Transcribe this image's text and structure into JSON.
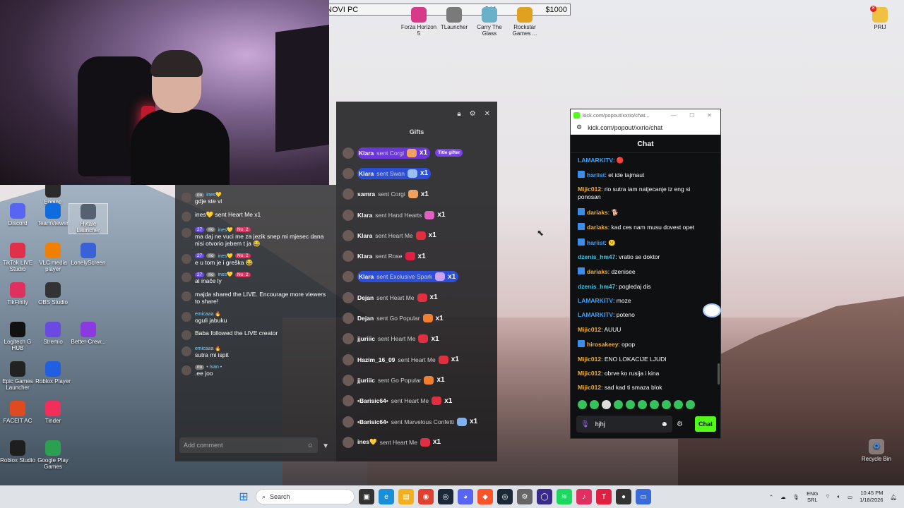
{
  "topbar": {
    "label": "NOVI PC",
    "mid": "$11",
    "right": "$1000"
  },
  "top_icons": [
    {
      "label": "Forza Horizon 5",
      "color": "#d83a8a"
    },
    {
      "label": "TLauncher",
      "color": "#7a7a7a"
    },
    {
      "label": "Carry The Glass",
      "color": "#6ab0c8"
    },
    {
      "label": "Rockstar Games ...",
      "color": "#e0a020"
    }
  ],
  "pril": "PRIJ",
  "left_icons": [
    {
      "label": "Engine",
      "color": "#2a2a2a"
    },
    {
      "label": "Discord",
      "color": "#5865f2"
    },
    {
      "label": "TeamViewer",
      "color": "#0e6be0"
    },
    {
      "label": "Hytale Launcher",
      "color": "#556070"
    },
    {
      "label": "TikTok LIVE Studio",
      "color": "#e0304a"
    },
    {
      "label": "VLC media player",
      "color": "#f08000"
    },
    {
      "label": "LonelyScreen",
      "color": "#3a62d8"
    },
    {
      "label": "TikFinity",
      "color": "#e03060"
    },
    {
      "label": "OBS Studio",
      "color": "#333333"
    },
    {
      "label": "Logitech G HUB",
      "color": "#111111"
    },
    {
      "label": "Stremio",
      "color": "#6a4ae0"
    },
    {
      "label": "Better-Crew...",
      "color": "#8a3ae0"
    },
    {
      "label": "Epic Games Launcher",
      "color": "#222222"
    },
    {
      "label": "Roblox Player",
      "color": "#2060e0"
    },
    {
      "label": "FACEIT AC",
      "color": "#e04a20"
    },
    {
      "label": "Tinder",
      "color": "#f0305a"
    },
    {
      "label": "Roblox Studio",
      "color": "#1e1e1e"
    },
    {
      "label": "Google Play Games",
      "color": "#2aa050"
    }
  ],
  "recycle_bin": "Recycle Bin",
  "live": {
    "gifts_title": "Gifts",
    "gifts": [
      {
        "name": "Klara",
        "gift": "sent Corgi",
        "count": "x1",
        "badge": "Title gifter",
        "style": "purple",
        "color": "#f0a060"
      },
      {
        "name": "Klara",
        "gift": "sent Swan",
        "count": "x1",
        "badge": "",
        "style": "blue",
        "color": "#9ac0f0"
      },
      {
        "name": "samra",
        "gift": "sent Corgi",
        "count": "x1",
        "badge": "",
        "style": "",
        "color": "#f0a060"
      },
      {
        "name": "Klara",
        "gift": "sent Hand Hearts",
        "count": "x1",
        "badge": "",
        "style": "",
        "color": "#e060c0"
      },
      {
        "name": "Klara",
        "gift": "sent Heart Me",
        "count": "x1",
        "badge": "",
        "style": "",
        "color": "#e03040"
      },
      {
        "name": "Klara",
        "gift": "sent Rose",
        "count": "x1",
        "badge": "",
        "style": "",
        "color": "#e02040"
      },
      {
        "name": "Klara",
        "gift": "sent Exclusive Spark",
        "count": "x1",
        "badge": "",
        "style": "blue",
        "color": "#d0a0f0"
      },
      {
        "name": "Dejan",
        "gift": "sent Heart Me",
        "count": "x1",
        "badge": "",
        "style": "",
        "color": "#e03040"
      },
      {
        "name": "Dejan",
        "gift": "sent Go Popular",
        "count": "x1",
        "badge": "",
        "style": "",
        "color": "#f08030"
      },
      {
        "name": "jjuriiic",
        "gift": "sent Heart Me",
        "count": "x1",
        "badge": "",
        "style": "",
        "color": "#e03040"
      },
      {
        "name": "Hazim_16_09",
        "gift": "sent Heart Me",
        "count": "x1",
        "badge": "",
        "style": "",
        "color": "#e03040"
      },
      {
        "name": "jjuriiic",
        "gift": "sent Go Popular",
        "count": "x1",
        "badge": "",
        "style": "",
        "color": "#f08030"
      },
      {
        "name": "•Barisic64•",
        "gift": "sent Heart Me",
        "count": "x1",
        "badge": "",
        "style": "",
        "color": "#e03040"
      },
      {
        "name": "•Barisic64•",
        "gift": "sent Marvelous Confetti",
        "count": "x1",
        "badge": "",
        "style": "",
        "color": "#80b0f0"
      },
      {
        "name": "ines💛",
        "gift": "sent Heart Me",
        "count": "x1",
        "badge": "",
        "style": "",
        "color": "#e03040"
      }
    ],
    "comments": [
      {
        "tags": [
          "rio",
          "ines💛"
        ],
        "text": "gdje ste vi"
      },
      {
        "tags": [],
        "text": "ines💛 sent Heart Me x1"
      },
      {
        "tags": [
          "27",
          "rio",
          "ines💛",
          "No. 2"
        ],
        "text": "ma daj ne vuci me za jezik snep mi mjesec dana nisi otvorio jebem t ja 😂"
      },
      {
        "tags": [
          "27",
          "rio",
          "ines💛",
          "No. 2"
        ],
        "text": "e u tom je i greška 😂"
      },
      {
        "tags": [
          "27",
          "rio",
          "ines💛",
          "No. 2"
        ],
        "text": "al inače ly"
      },
      {
        "tags": [],
        "text": "majda shared the LIVE. Encourage more viewers to share!"
      },
      {
        "tags": [
          "emicaaa 🔥"
        ],
        "text": "oguli jabuku"
      },
      {
        "tags": [],
        "text": "Baba followed the LIVE creator"
      },
      {
        "tags": [
          "emicaaa 🔥"
        ],
        "text": "sutra mi ispit"
      },
      {
        "tags": [
          "rio",
          "• Ivan •"
        ],
        "text": ".ee joo"
      }
    ],
    "add_comment": "Add comment"
  },
  "kick": {
    "window_title": "kick.com/popout/xxrio/chat...",
    "url": "kick.com/popout/xxrio/chat",
    "header": "Chat",
    "messages": [
      {
        "user": "LAMARKITV",
        "text": "🔴",
        "cls": "u-blue",
        "icon": false
      },
      {
        "user": "hariist",
        "text": "et ide tajmaut",
        "cls": "u-blue",
        "icon": true
      },
      {
        "user": "Mijic012",
        "text": "rio sutra iam natjecanje iz eng si ponosan",
        "cls": "u-orange",
        "icon": false
      },
      {
        "user": "dariaks",
        "text": "🐕",
        "cls": "u-orange",
        "icon": true
      },
      {
        "user": "dariaks",
        "text": "kad ces nam musu dovest opet",
        "cls": "u-orange",
        "icon": true
      },
      {
        "user": "hariist",
        "text": "🙁",
        "cls": "u-blue",
        "icon": true
      },
      {
        "user": "dzenis_hm47",
        "text": "vratio se doktor",
        "cls": "u-cyan",
        "icon": false
      },
      {
        "user": "dariaks",
        "text": "dzenisee",
        "cls": "u-orange",
        "icon": true
      },
      {
        "user": "dzenis_hm47",
        "text": "pogledaj dis",
        "cls": "u-cyan",
        "icon": false
      },
      {
        "user": "LAMARKITV",
        "text": "moze",
        "cls": "u-blue",
        "icon": false
      },
      {
        "user": "LAMARKITV",
        "text": "poteno",
        "cls": "u-blue",
        "icon": false
      },
      {
        "user": "Mijic012",
        "text": "AUUU",
        "cls": "u-orange",
        "icon": false
      },
      {
        "user": "hirosakeey",
        "text": "opop",
        "cls": "u-orange",
        "icon": true
      },
      {
        "user": "Mijic012",
        "text": "ENO LOKACIJE LJUDI",
        "cls": "u-orange",
        "icon": false
      },
      {
        "user": "Mijic012",
        "text": "obrve ko rusija i kina",
        "cls": "u-orange",
        "icon": false
      },
      {
        "user": "Mijic012",
        "text": "sad kad ti smaza blok",
        "cls": "u-orange",
        "icon": false
      }
    ],
    "input_value": "hjhj",
    "chat_button": "Chat"
  },
  "taskbar": {
    "search": "Search",
    "lang": "ENG",
    "region": "SRL",
    "time": "10:45 PM",
    "date": "1/18/2026"
  }
}
